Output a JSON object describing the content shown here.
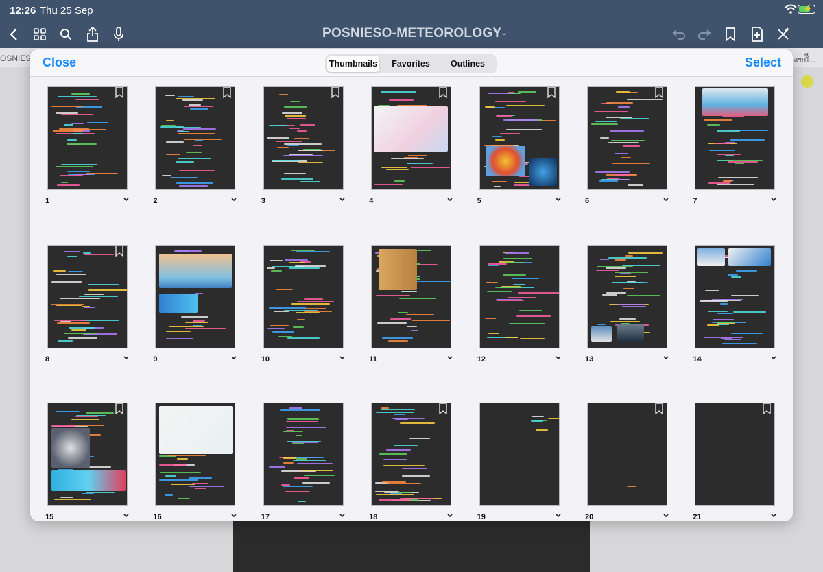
{
  "status_bar": {
    "time": "12:26",
    "date": "Thu 25 Sep"
  },
  "toolbar": {
    "title": "POSNIESO-METEOROLOGY",
    "icons": [
      "back-icon",
      "grid-icon",
      "search-icon",
      "share-icon",
      "microphone-icon",
      "undo-icon",
      "redo-icon",
      "bookmark-icon",
      "add-page-icon",
      "close-pen-icon"
    ]
  },
  "background": {
    "left_tab": "OSNIESO",
    "right_tab": "เลขบัี..."
  },
  "modal": {
    "close_label": "Close",
    "select_label": "Select",
    "tabs": [
      {
        "label": "Thumbnails",
        "active": true
      },
      {
        "label": "Favorites",
        "active": false
      },
      {
        "label": "Outlines",
        "active": false
      }
    ]
  },
  "pages": [
    {
      "number": "1",
      "bookmark": true,
      "content": "notes"
    },
    {
      "number": "2",
      "bookmark": true,
      "content": "notes"
    },
    {
      "number": "3",
      "bookmark": true,
      "content": "notes"
    },
    {
      "number": "4",
      "bookmark": true,
      "content": "notes-image"
    },
    {
      "number": "5",
      "bookmark": true,
      "content": "notes-globe"
    },
    {
      "number": "6",
      "bookmark": true,
      "content": "notes"
    },
    {
      "number": "7",
      "bookmark": false,
      "content": "notes-image-top"
    },
    {
      "number": "8",
      "bookmark": true,
      "content": "notes"
    },
    {
      "number": "9",
      "bookmark": false,
      "content": "notes-image"
    },
    {
      "number": "10",
      "bookmark": false,
      "content": "notes"
    },
    {
      "number": "11",
      "bookmark": false,
      "content": "notes-image"
    },
    {
      "number": "12",
      "bookmark": false,
      "content": "notes"
    },
    {
      "number": "13",
      "bookmark": false,
      "content": "notes-photos"
    },
    {
      "number": "14",
      "bookmark": false,
      "content": "notes-image-top"
    },
    {
      "number": "15",
      "bookmark": true,
      "content": "notes-image"
    },
    {
      "number": "16",
      "bookmark": false,
      "content": "notes-image"
    },
    {
      "number": "17",
      "bookmark": false,
      "content": "notes"
    },
    {
      "number": "18",
      "bookmark": true,
      "content": "notes"
    },
    {
      "number": "19",
      "bookmark": false,
      "content": "sparse"
    },
    {
      "number": "20",
      "bookmark": true,
      "content": "sparse"
    },
    {
      "number": "21",
      "bookmark": true,
      "content": "blank"
    }
  ],
  "colors": {
    "accent": "#1a8cff",
    "toolbar": "#3f536c",
    "thumb_bg": "#2c2c2c"
  }
}
